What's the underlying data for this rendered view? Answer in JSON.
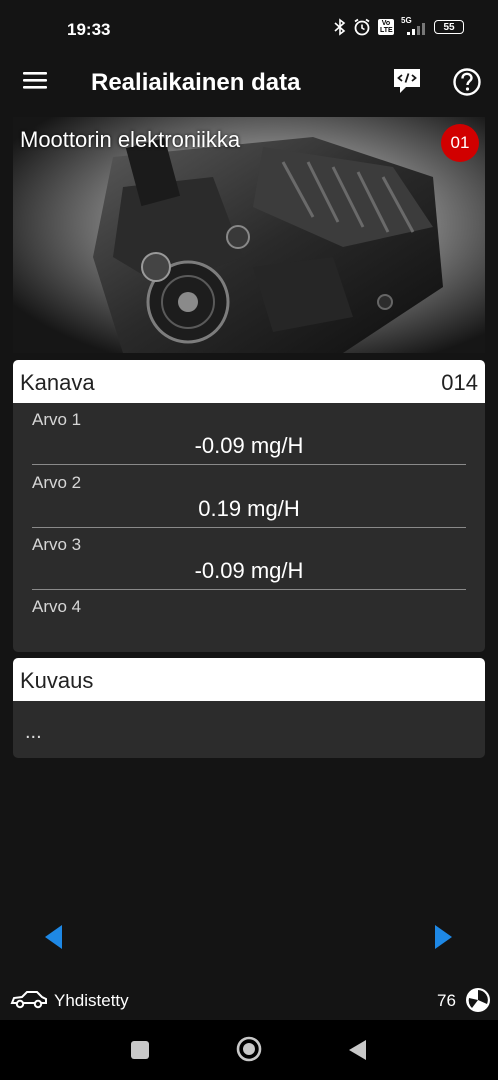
{
  "status_bar": {
    "time": "19:33",
    "battery": "55",
    "network": "5G",
    "volte": "Vo LTE",
    "icons": [
      "bluetooth-icon",
      "alarm-icon",
      "volte-icon",
      "signal-icon",
      "battery-icon"
    ]
  },
  "app_bar": {
    "title": "Realiaikainen data",
    "icons": [
      "menu-icon",
      "code-icon",
      "help-icon"
    ]
  },
  "engine_card": {
    "title": "Moottorin elektroniikka",
    "badge": "01"
  },
  "channel_card": {
    "label": "Kanava",
    "value": "014",
    "rows": [
      {
        "label": "Arvo 1",
        "value": "-0.09 mg/H"
      },
      {
        "label": "Arvo 2",
        "value": "0.19 mg/H"
      },
      {
        "label": "Arvo 3",
        "value": "-0.09 mg/H"
      },
      {
        "label": "Arvo 4",
        "value": ""
      }
    ]
  },
  "description_card": {
    "label": "Kuvaus",
    "text": "..."
  },
  "navigation": {
    "prev_icon": "triangle-left-icon",
    "next_icon": "triangle-right-icon"
  },
  "footer": {
    "connection": "Yhdistetty",
    "counter": "76"
  },
  "colors": {
    "background": "#141414",
    "card": "#2c2c2c",
    "accent_blue": "#1e88e5",
    "badge_red": "#d10000"
  }
}
